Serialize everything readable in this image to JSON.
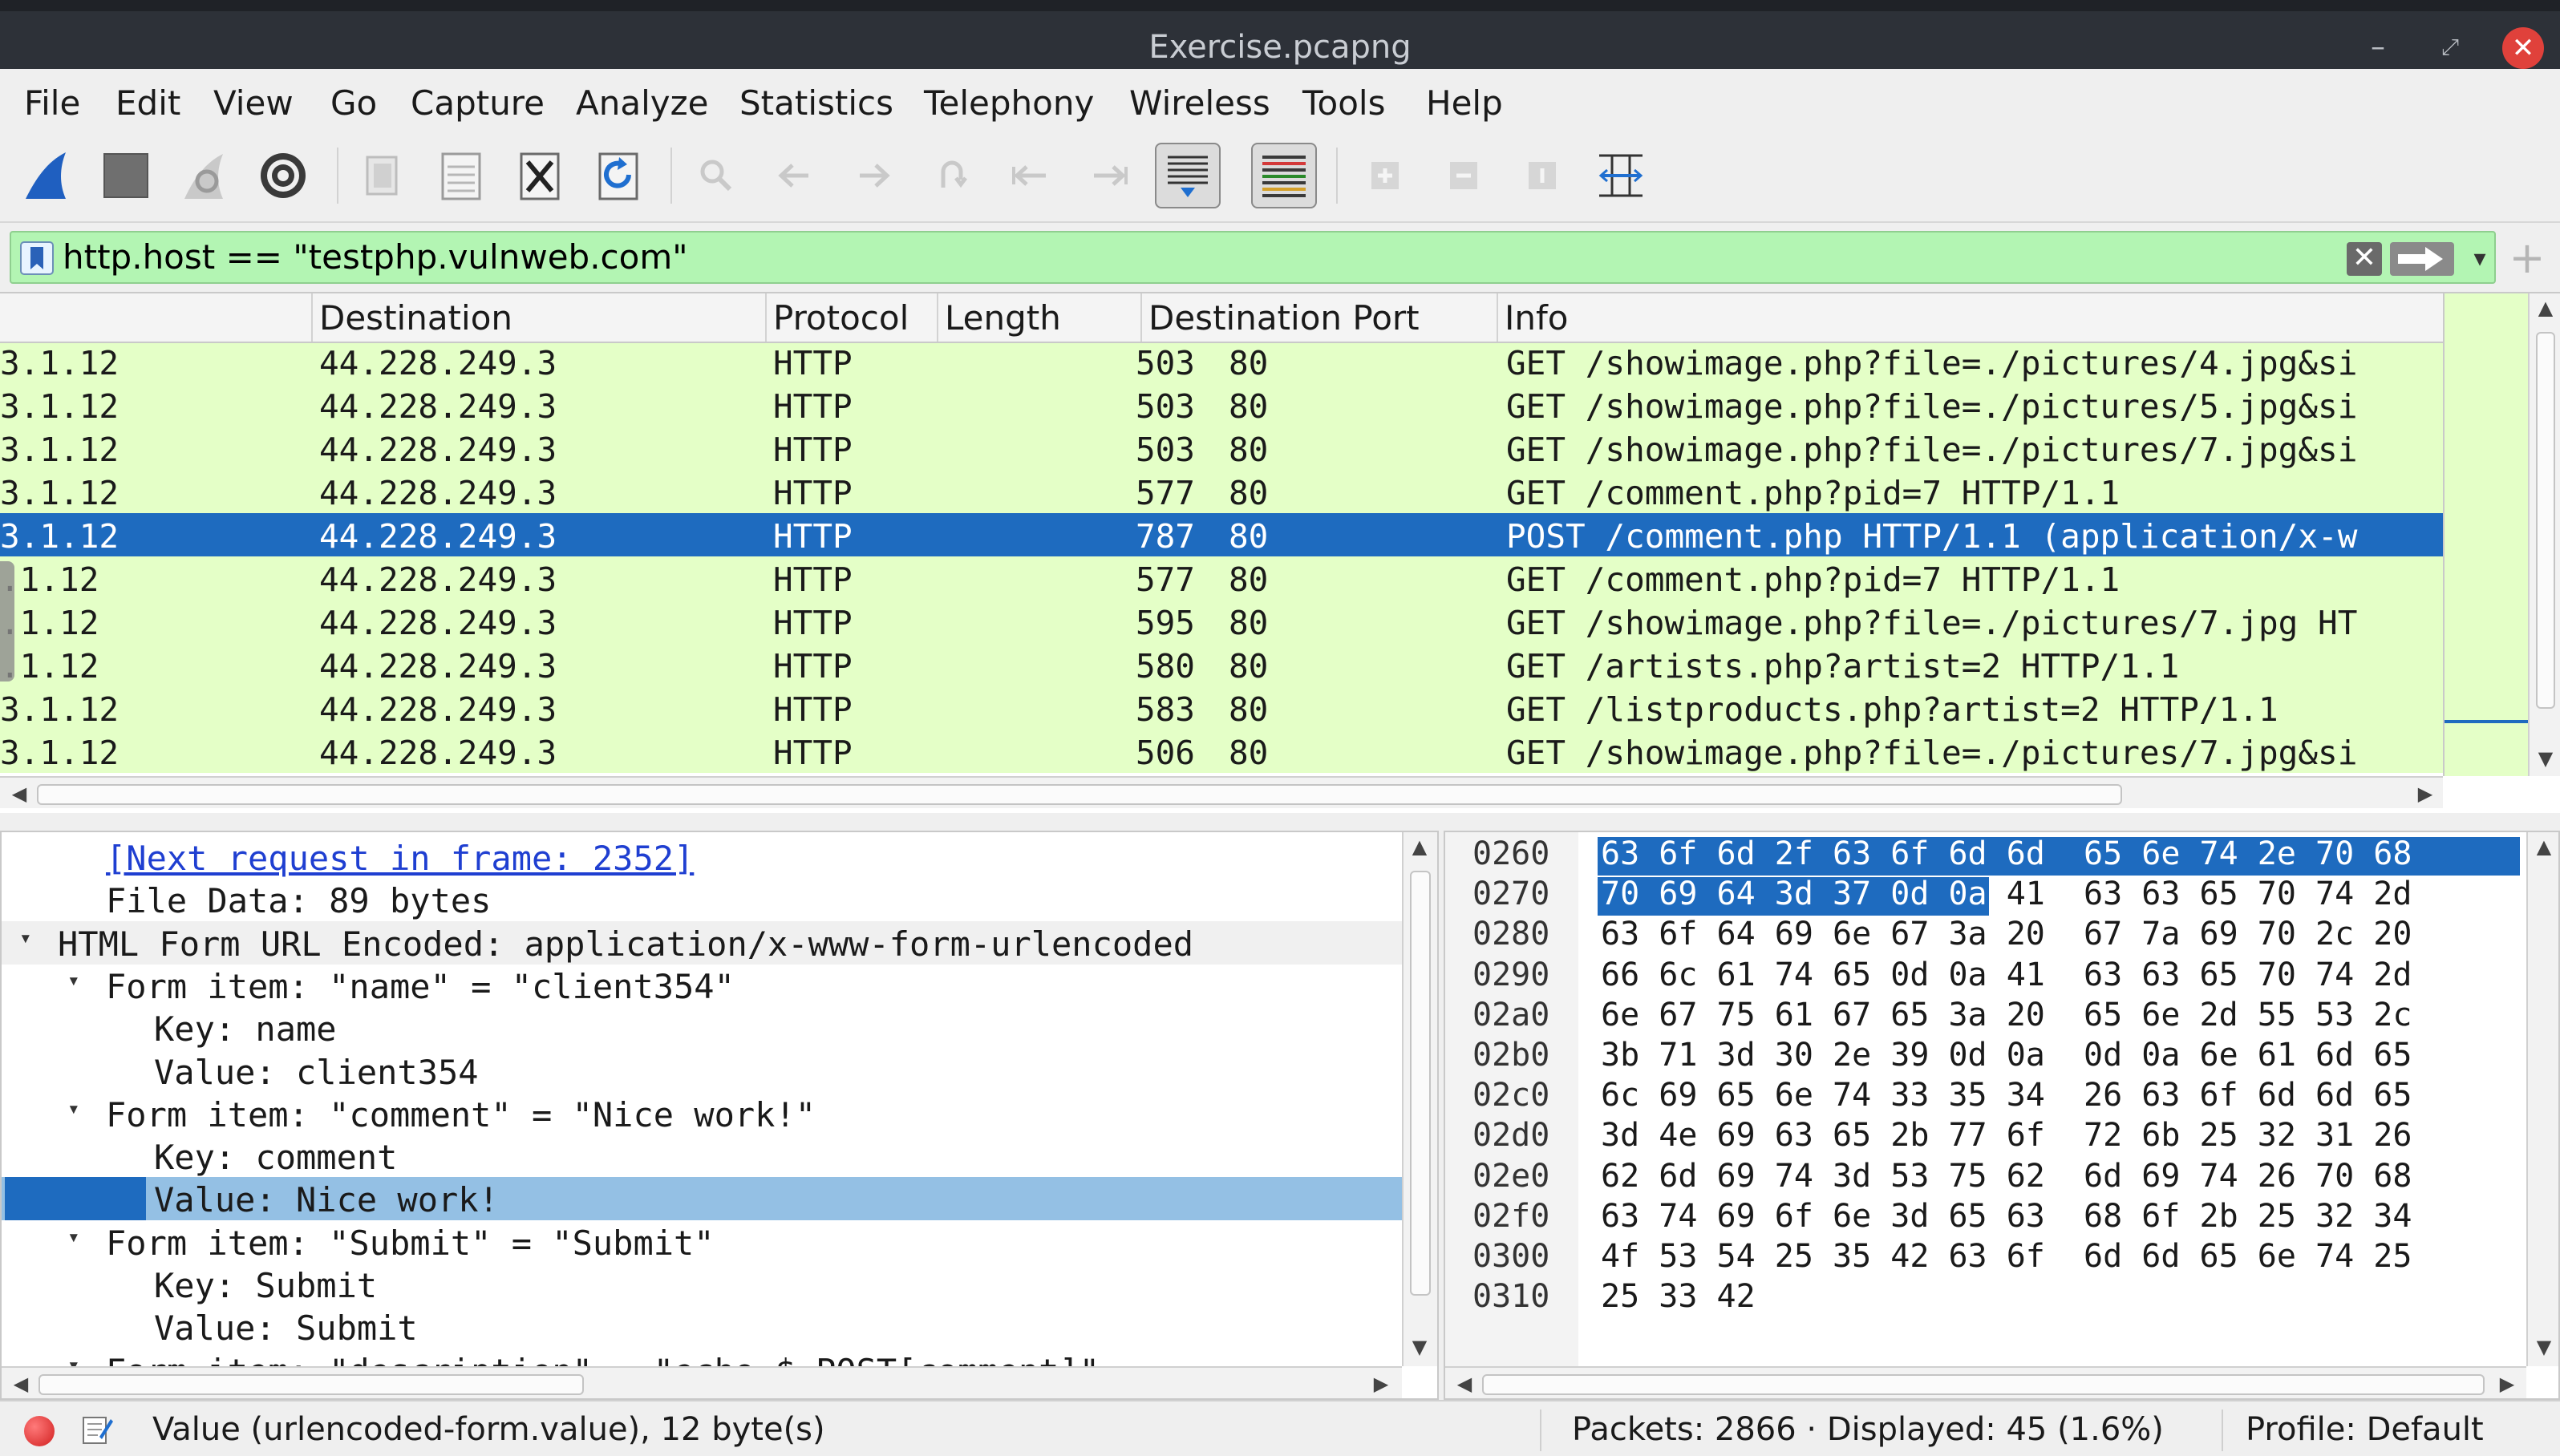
{
  "window": {
    "title": "Exercise.pcapng"
  },
  "menu": [
    "File",
    "Edit",
    "View",
    "Go",
    "Capture",
    "Analyze",
    "Statistics",
    "Telephony",
    "Wireless",
    "Tools",
    "Help"
  ],
  "toolbar": {
    "icons": [
      "shark-fin-start-icon",
      "stop-icon",
      "restart-icon",
      "capture-options-gear-icon",
      "open-file-icon",
      "save-file-icon",
      "close-file-icon",
      "reload-icon",
      "find-icon",
      "go-back-icon",
      "go-forward-icon",
      "go-to-packet-icon",
      "first-packet-icon",
      "last-packet-icon",
      "autoscroll-icon",
      "colorize-icon",
      "zoom-in-icon",
      "zoom-out-icon",
      "normal-size-icon",
      "resize-columns-icon"
    ]
  },
  "filter": {
    "value": "http.host == \"testphp.vulnweb.com\"",
    "clear_label": "✕"
  },
  "packet_list": {
    "columns": [
      "",
      "Destination",
      "Protocol",
      "Length",
      "Destination Port",
      "Info"
    ],
    "rows": [
      {
        "src": "3.1.12",
        "dst": "44.228.249.3",
        "proto": "HTTP",
        "len": "503",
        "port": "80",
        "info": "GET /showimage.php?file=./pictures/4.jpg&si"
      },
      {
        "src": "3.1.12",
        "dst": "44.228.249.3",
        "proto": "HTTP",
        "len": "503",
        "port": "80",
        "info": "GET /showimage.php?file=./pictures/5.jpg&si"
      },
      {
        "src": "3.1.12",
        "dst": "44.228.249.3",
        "proto": "HTTP",
        "len": "503",
        "port": "80",
        "info": "GET /showimage.php?file=./pictures/7.jpg&si"
      },
      {
        "src": "3.1.12",
        "dst": "44.228.249.3",
        "proto": "HTTP",
        "len": "577",
        "port": "80",
        "info": "GET /comment.php?pid=7 HTTP/1.1"
      },
      {
        "src": "3.1.12",
        "dst": "44.228.249.3",
        "proto": "HTTP",
        "len": "787",
        "port": "80",
        "info": "POST /comment.php HTTP/1.1  (application/x-w",
        "selected": true
      },
      {
        "src": ".1.12",
        "dst": "44.228.249.3",
        "proto": "HTTP",
        "len": "577",
        "port": "80",
        "info": "GET /comment.php?pid=7 HTTP/1.1"
      },
      {
        "src": ".1.12",
        "dst": "44.228.249.3",
        "proto": "HTTP",
        "len": "595",
        "port": "80",
        "info": "GET /showimage.php?file=./pictures/7.jpg HT"
      },
      {
        "src": ".1.12",
        "dst": "44.228.249.3",
        "proto": "HTTP",
        "len": "580",
        "port": "80",
        "info": "GET /artists.php?artist=2 HTTP/1.1"
      },
      {
        "src": "3.1.12",
        "dst": "44.228.249.3",
        "proto": "HTTP",
        "len": "583",
        "port": "80",
        "info": "GET /listproducts.php?artist=2 HTTP/1.1"
      },
      {
        "src": "3.1.12",
        "dst": "44.228.249.3",
        "proto": "HTTP",
        "len": "506",
        "port": "80",
        "info": "GET /showimage.php?file=./pictures/7.jpg&si"
      }
    ]
  },
  "details": {
    "rows": [
      {
        "indent": 2,
        "text": "[Next request in frame: 2352]",
        "link": true
      },
      {
        "indent": 2,
        "text": "File Data: 89 bytes"
      },
      {
        "indent": 1,
        "caret": "▾",
        "text": "HTML Form URL Encoded: application/x-www-form-urlencoded",
        "section": true
      },
      {
        "indent": 2,
        "caret": "▾",
        "text": "Form item: \"name\" = \"client354\""
      },
      {
        "indent": 3,
        "text": "Key: name"
      },
      {
        "indent": 3,
        "text": "Value: client354"
      },
      {
        "indent": 2,
        "caret": "▾",
        "text": "Form item: \"comment\" = \"Nice work!\""
      },
      {
        "indent": 3,
        "text": "Key: comment"
      },
      {
        "indent": 3,
        "text": "Value: Nice work!",
        "selected": true
      },
      {
        "indent": 2,
        "caret": "▾",
        "text": "Form item: \"Submit\" = \"Submit\""
      },
      {
        "indent": 3,
        "text": "Key: Submit"
      },
      {
        "indent": 3,
        "text": "Value: Submit"
      },
      {
        "indent": 2,
        "caret": "▾",
        "text": "Form item: \"description\" = \"echo $_POST[comment]\"",
        "cut": true
      }
    ]
  },
  "bytes": {
    "rows": [
      {
        "offset": "0260",
        "hex": "63 6f 6d 2f 63 6f 6d 6d  65 6e 74 2e 70 68",
        "hl": "all"
      },
      {
        "offset": "0270",
        "hex": "70 69 64 3d 37 0d 0a 41  63 63 65 70 74 2d",
        "hl": "first7"
      },
      {
        "offset": "0280",
        "hex": "63 6f 64 69 6e 67 3a 20  67 7a 69 70 2c 20"
      },
      {
        "offset": "0290",
        "hex": "66 6c 61 74 65 0d 0a 41  63 63 65 70 74 2d"
      },
      {
        "offset": "02a0",
        "hex": "6e 67 75 61 67 65 3a 20  65 6e 2d 55 53 2c"
      },
      {
        "offset": "02b0",
        "hex": "3b 71 3d 30 2e 39 0d 0a  0d 0a 6e 61 6d 65"
      },
      {
        "offset": "02c0",
        "hex": "6c 69 65 6e 74 33 35 34  26 63 6f 6d 6d 65"
      },
      {
        "offset": "02d0",
        "hex": "3d 4e 69 63 65 2b 77 6f  72 6b 25 32 31 26"
      },
      {
        "offset": "02e0",
        "hex": "62 6d 69 74 3d 53 75 62  6d 69 74 26 70 68"
      },
      {
        "offset": "02f0",
        "hex": "63 74 69 6f 6e 3d 65 63  68 6f 2b 25 32 34"
      },
      {
        "offset": "0300",
        "hex": "4f 53 54 25 35 42 63 6f  6d 6d 65 6e 74 25"
      },
      {
        "offset": "0310",
        "hex": "25 33 42"
      }
    ]
  },
  "status": {
    "field": "Value (urlencoded-form.value), 12 byte(s)",
    "packets": "Packets: 2866 · Displayed: 45 (1.6%)",
    "profile": "Profile: Default"
  },
  "colors": {
    "selected": "#1e6bbf",
    "http_row": "#e4ffc7",
    "filter_ok": "#b3f5b3",
    "detail_selected": "#94c0e4"
  }
}
